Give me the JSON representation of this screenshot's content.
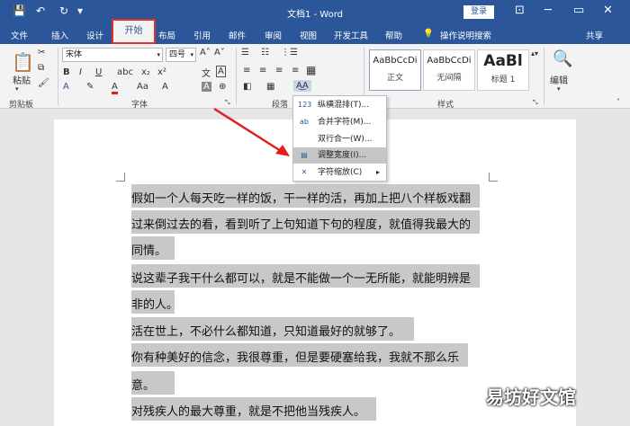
{
  "titlebar": {
    "doc_title": "文档1 - Word",
    "login": "登录",
    "save_icon": "💾",
    "undo_icon": "↶",
    "redo_icon": "↻",
    "more_icon": "▾",
    "minimize": "─",
    "restore": "▭",
    "close": "✕",
    "ribbon_display": "⊡"
  },
  "tabs": {
    "file": "文件",
    "insert": "插入",
    "design": "设计",
    "home": "开始",
    "layout": "布局",
    "references": "引用",
    "mailings": "邮件",
    "review": "审阅",
    "view": "视图",
    "developer": "开发工具",
    "help": "帮助",
    "tellme": "操作说明搜索",
    "share": "共享"
  },
  "ribbon": {
    "paste": "粘贴",
    "clipboard": "剪贴板",
    "font_name": "宋体",
    "font_size": "四号",
    "font_group": "字体",
    "paragraph_group": "段落",
    "styles_group": "样式",
    "editing": "编辑",
    "styles": [
      {
        "preview": "AaBbCcDi",
        "name": "正文"
      },
      {
        "preview": "AaBbCcDi",
        "name": "无间隔"
      },
      {
        "preview": "AaBl",
        "name": "标题 1"
      }
    ],
    "bold": "B",
    "italic": "I",
    "underline": "U",
    "wen": "文",
    "clear_format": "A",
    "highlight": "A"
  },
  "menu": {
    "items": [
      {
        "icon": "123",
        "label": "纵横混排(T)..."
      },
      {
        "icon": "ab",
        "label": "合并字符(M)..."
      },
      {
        "icon": "",
        "label": "双行合一(W)..."
      },
      {
        "icon": "▤",
        "label": "调整宽度(I)..."
      },
      {
        "icon": "✕",
        "label": "字符缩放(C)"
      }
    ],
    "submenu_arrow": "▸"
  },
  "document": {
    "lines": [
      "假如一个人每天吃一样的饭，干一样的活，再加上把八个样板戏翻",
      "过来倒过去的看，看到听了上句知道下句的程度，就值得我最大的",
      "同情。",
      "说这辈子我干什么都可以，就是不能做一个一无所能，就能明辨是",
      "非的人。",
      "活在世上，不必什么都知道，只知道最好的就够了。",
      "你有种美好的信念，我很尊重，但是要硬塞给我，我就不那么乐",
      "意。",
      "对残疾人的最大尊重，就是不把他当残疾人。"
    ]
  },
  "watermark": "易坊好文馆"
}
